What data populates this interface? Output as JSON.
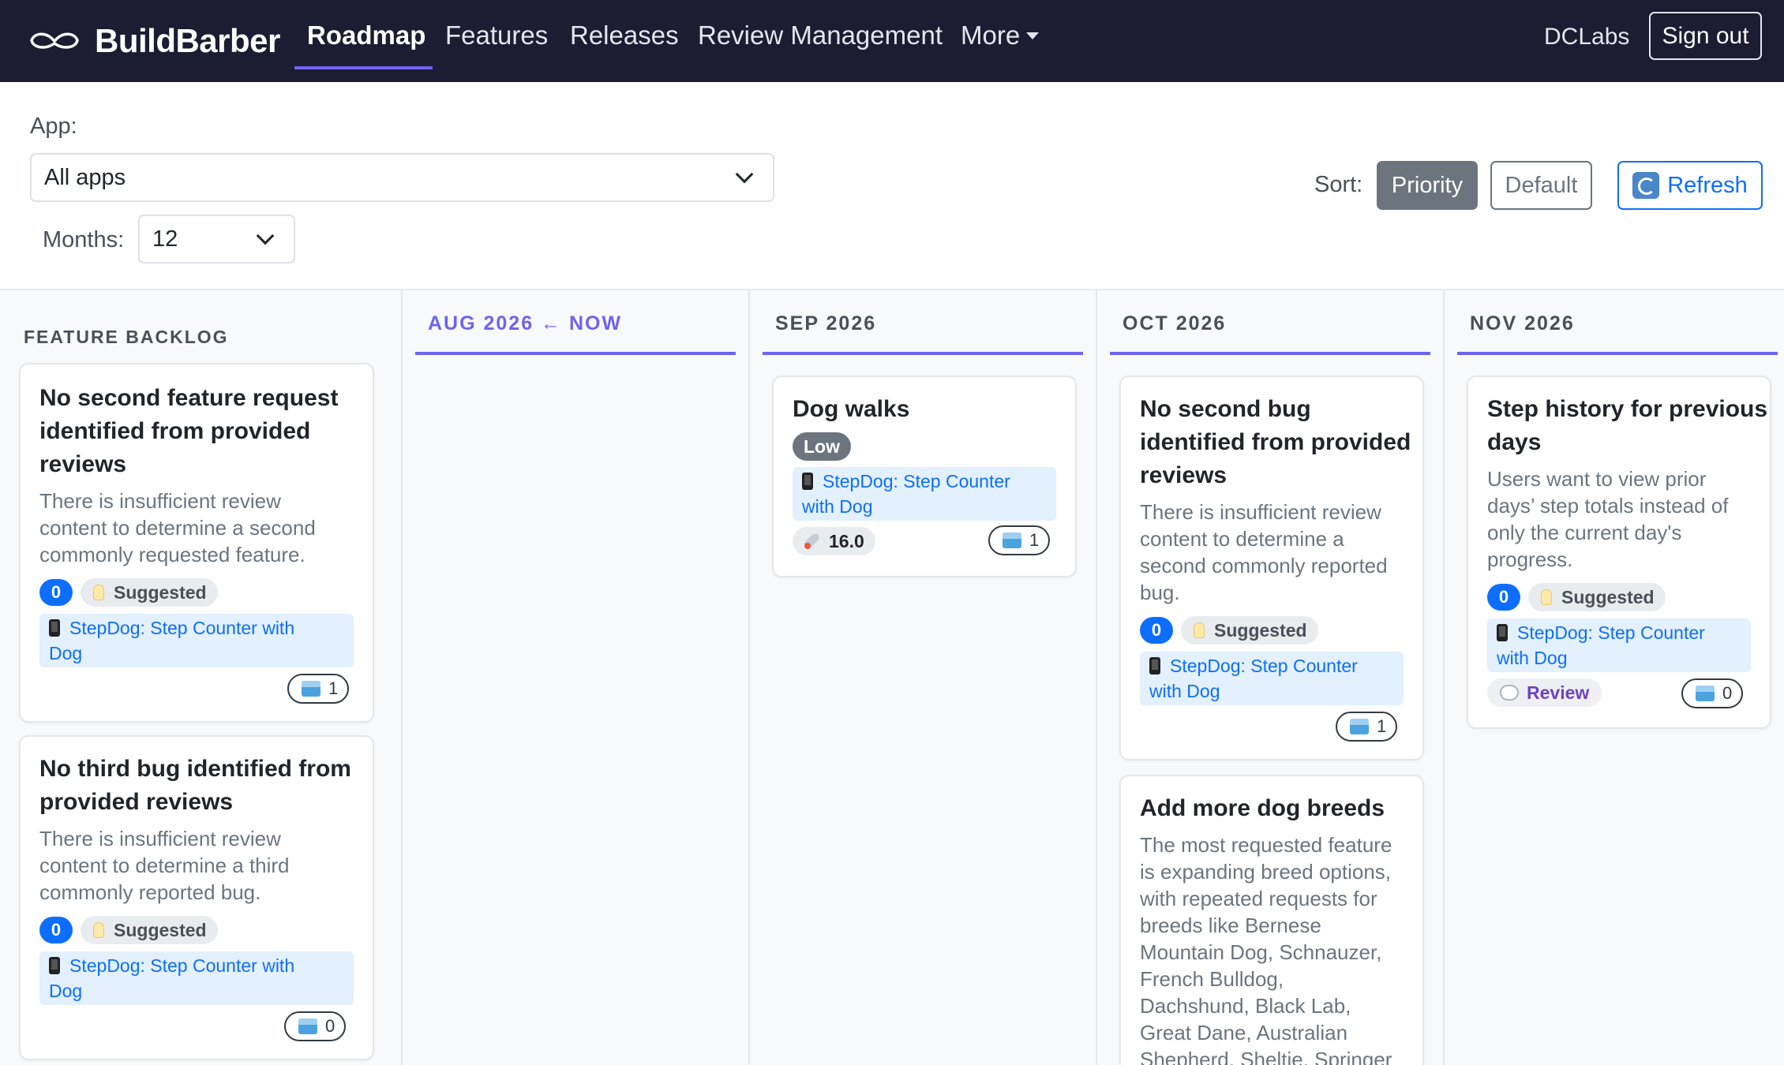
{
  "nav": {
    "brand": "BuildBarber",
    "items": [
      {
        "label": "Roadmap",
        "active": true
      },
      {
        "label": "Features"
      },
      {
        "label": "Releases"
      },
      {
        "label": "Review Management"
      },
      {
        "label": "More"
      }
    ],
    "org": "DCLabs",
    "signout": "Sign out"
  },
  "filters": {
    "app_label": "App:",
    "app_value": "All apps",
    "months_label": "Months:",
    "months_value": "12",
    "sort_label": "Sort:",
    "sort_options": [
      "Priority",
      "Default"
    ],
    "sort_selected": "Priority",
    "refresh": "Refresh"
  },
  "backlog": {
    "title": "FEATURE BACKLOG",
    "cards": [
      {
        "title_lines": [
          "No second feature request",
          "identified from provided",
          "reviews"
        ],
        "desc_lines": [
          "There is insufficient review",
          "content to determine a second",
          "commonly requested feature."
        ],
        "count": "0",
        "status": "Suggested",
        "app_lines": [
          "StepDog: Step Counter with",
          "Dog"
        ],
        "votes": "1"
      },
      {
        "title_lines": [
          "No third bug identified from",
          "provided reviews"
        ],
        "desc_lines": [
          "There is insufficient review",
          "content to determine a third",
          "commonly reported bug."
        ],
        "count": "0",
        "status": "Suggested",
        "app_lines": [
          "StepDog: Step Counter with",
          "Dog"
        ],
        "votes": "0"
      }
    ]
  },
  "months": [
    {
      "label": "AUG 2026 ← NOW",
      "is_now": true,
      "cards": []
    },
    {
      "label": "SEP 2026",
      "cards": [
        {
          "title_lines": [
            "Dog walks"
          ],
          "priority": "Low",
          "app_lines": [
            "StepDog: Step Counter",
            "with Dog"
          ],
          "score": "16.0",
          "votes": "1"
        }
      ]
    },
    {
      "label": "OCT 2026",
      "cards": [
        {
          "title_lines": [
            "No second bug",
            "identified from provided",
            "reviews"
          ],
          "desc_lines": [
            "There is insufficient review",
            "content to determine a",
            "second commonly reported",
            "bug."
          ],
          "count": "0",
          "status": "Suggested",
          "app_lines": [
            "StepDog: Step Counter",
            "with Dog"
          ],
          "votes": "1"
        },
        {
          "title_lines": [
            "Add more dog breeds"
          ],
          "desc_lines": [
            "The most requested feature",
            "is expanding breed options,",
            "with repeated requests for",
            "breeds like Bernese",
            "Mountain Dog, Schnauzer,",
            "French Bulldog,",
            "Dachshund, Black Lab,",
            "Great Dane, Australian",
            "Shepherd, Sheltie, Springer"
          ]
        }
      ]
    },
    {
      "label": "NOV 2026",
      "cards": [
        {
          "title_lines": [
            "Step history for previous",
            "days"
          ],
          "desc_lines": [
            "Users want to view prior",
            "days’ step totals instead of",
            "only the current day's",
            "progress."
          ],
          "count": "0",
          "status": "Suggested",
          "app_lines": [
            "StepDog: Step Counter",
            "with Dog"
          ],
          "source": "Review",
          "votes": "0"
        }
      ]
    }
  ]
}
